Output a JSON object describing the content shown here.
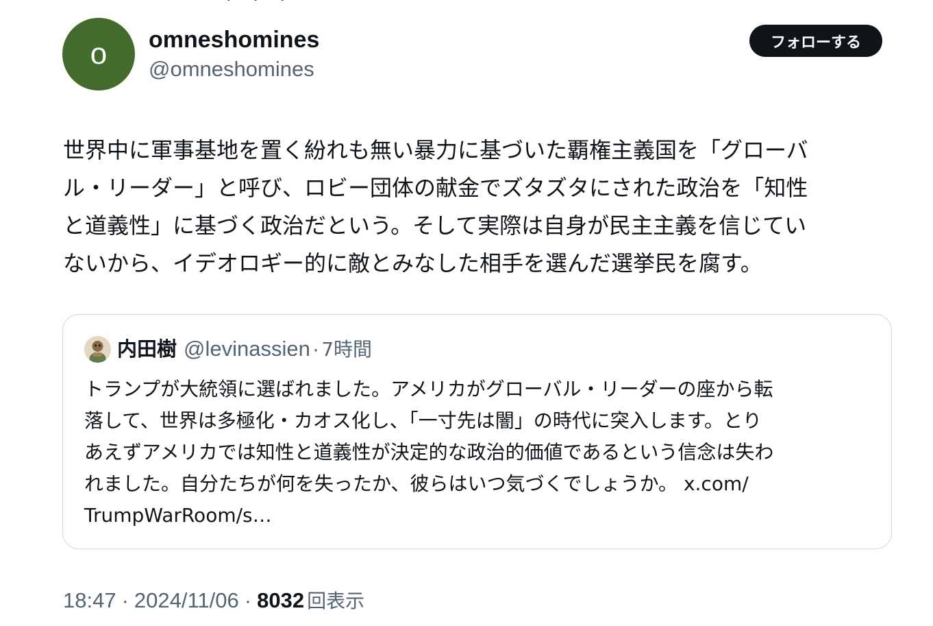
{
  "author": {
    "avatar_letter": "o",
    "avatar_color": "#426b2c",
    "display_name": "omneshomines",
    "handle": "@omneshomines"
  },
  "follow_button": {
    "label": "フォローする"
  },
  "tweet": {
    "text": "世界中に軍事基地を置く紛れも無い暴力に基づいた覇権主義国を「グローバ\nル・リーダー」と呼び、ロビー団体の献金でズタズタにされた政治を「知性\nと道義性」に基づく政治だという。そして実際は自身が民主主義を信じてい\nないから、イデオロギー的に敵とみなした相手を選んだ選挙民を腐す。"
  },
  "quote": {
    "avatar_icon": "user-avatar-icon",
    "name": "内田樹",
    "handle": "@levinassien",
    "separator": "·",
    "time": "7時間",
    "text": "トランプが大統領に選ばれました。アメリカがグローバル・リーダーの座から転\n落して、世界は多極化・カオス化し、「一寸先は闇」の時代に突入します。とり\nあえずアメリカでは知性と道義性が決定的な政治的価値であるという信念は失わ\nれました。自分たちが何を失ったか、彼らはいつ気づくでしょうか。 ",
    "link_text": "x.com/\nTrumpWarRoom/s…"
  },
  "meta": {
    "time": "18:47",
    "separator": "·",
    "date": "2024/11/06",
    "views": "8032",
    "views_label": "回表示"
  }
}
